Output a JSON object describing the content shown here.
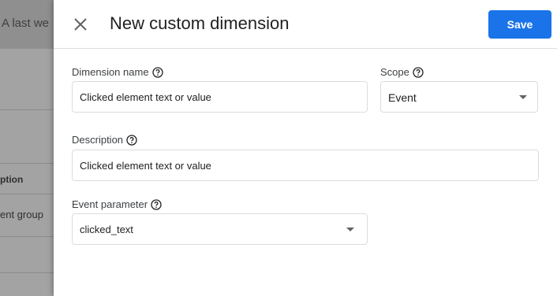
{
  "background": {
    "top_text": "A last we",
    "column_header": "ption",
    "cell_text": "ent group"
  },
  "panel": {
    "title": "New custom dimension",
    "save_label": "Save"
  },
  "form": {
    "dimension_name": {
      "label": "Dimension name",
      "value": "Clicked element text or value"
    },
    "scope": {
      "label": "Scope",
      "value": "Event"
    },
    "description": {
      "label": "Description",
      "value": "Clicked element text or value"
    },
    "event_parameter": {
      "label": "Event parameter",
      "value": "clicked_text"
    }
  },
  "colors": {
    "accent": "#1a73e8",
    "border": "#dadce0",
    "overlay": "#9e9e9e"
  },
  "icons": {
    "close": "close-icon",
    "help": "help-circle-icon",
    "dropdown": "arrow-drop-down-icon"
  }
}
